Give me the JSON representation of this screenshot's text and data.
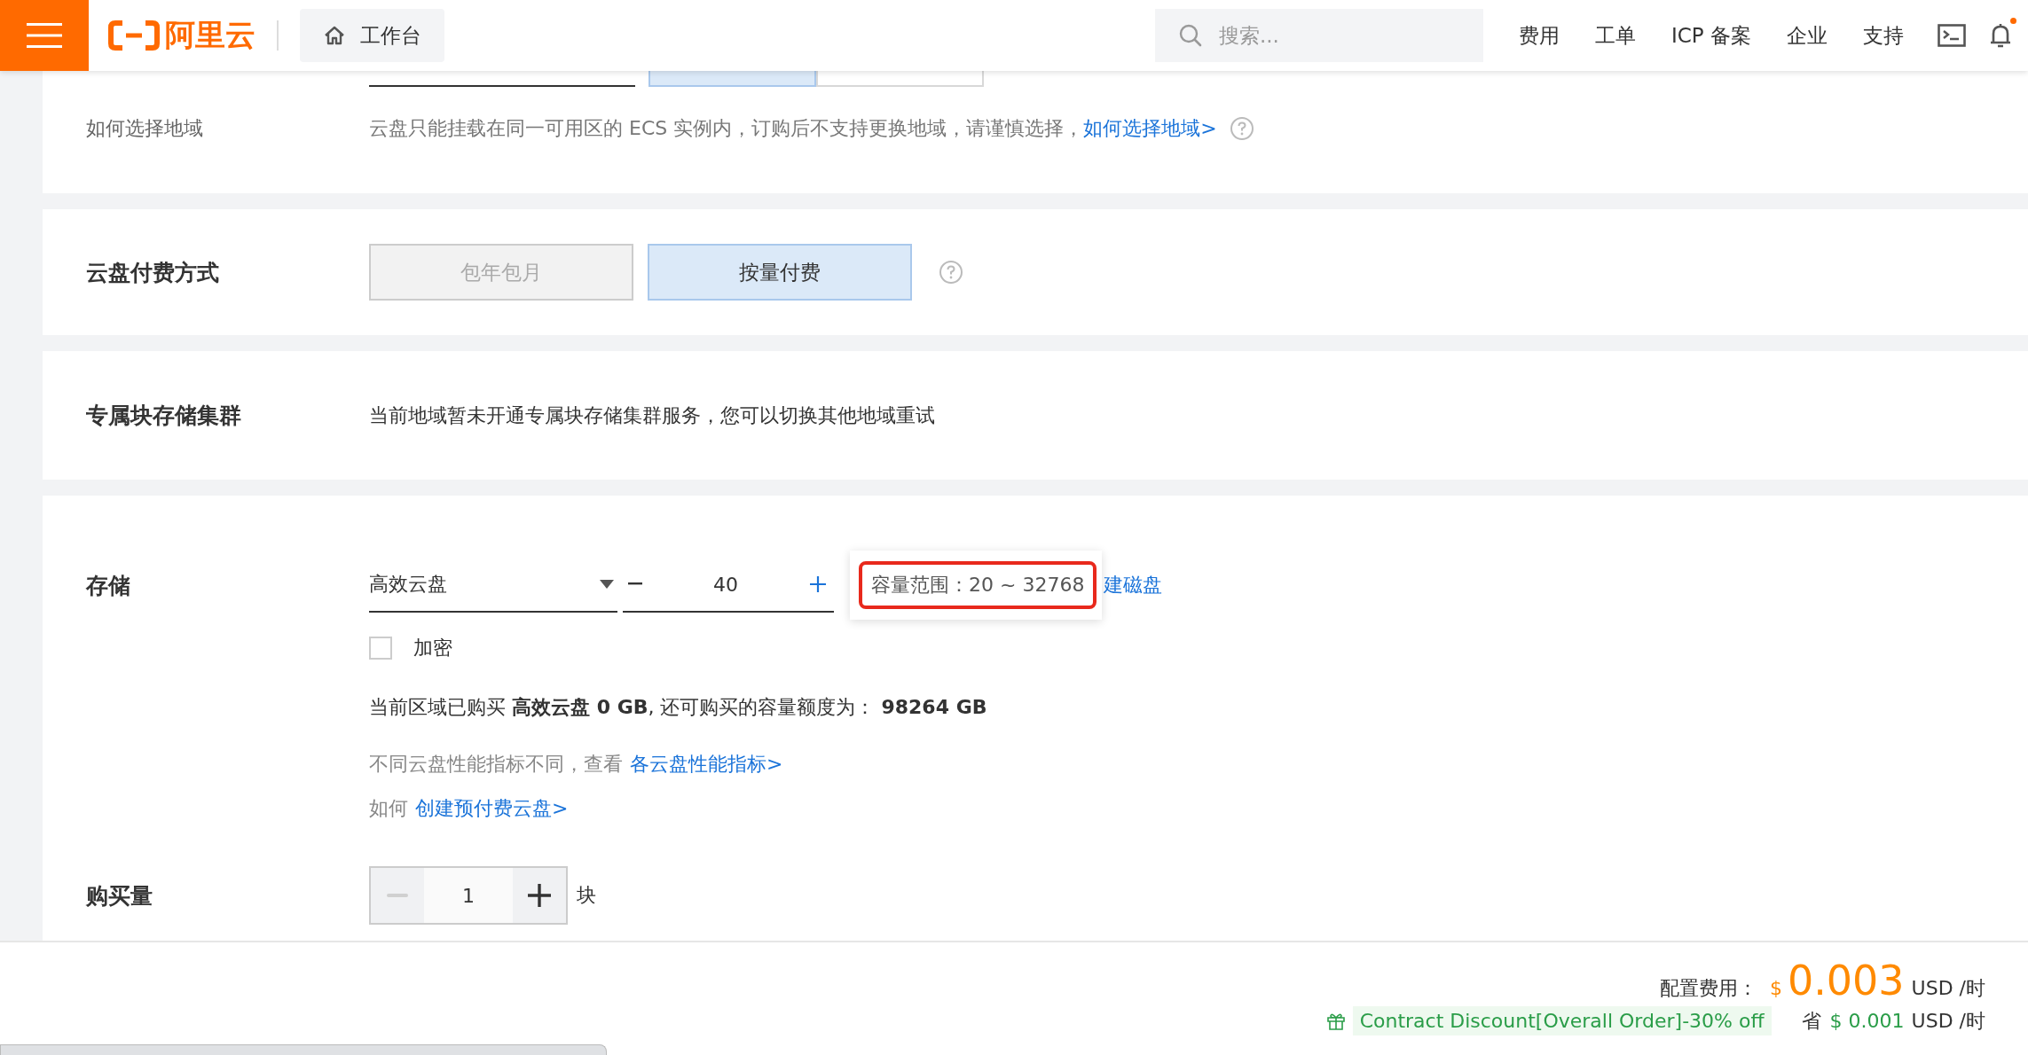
{
  "header": {
    "logo": "阿里云",
    "workbench": "工作台",
    "search": {
      "placeholder": "搜索..."
    },
    "nav": [
      "费用",
      "工单",
      "ICP 备案",
      "企业",
      "支持"
    ],
    "notification_dot": true
  },
  "region_section": {
    "label": "如何选择地域",
    "note": "云盘只能挂载在同一可用区的 ECS 实例内，订购后不支持更换地域，请谨慎选择，",
    "link": "如何选择地域>"
  },
  "billing": {
    "label": "云盘付费方式",
    "options": [
      {
        "label": "包年包月",
        "selected": false,
        "disabled": true
      },
      {
        "label": "按量付费",
        "selected": true,
        "disabled": false
      }
    ]
  },
  "dedicated": {
    "label": "专属块存储集群",
    "text": "当前地域暂未开通专属块存储集群服务，您可以切换其他地域重试"
  },
  "storage": {
    "label": "存储",
    "disk_type": "高效云盘",
    "size": "40",
    "tooltip": "容量范围：20 ~ 32768",
    "create_link": "建磁盘",
    "encrypt": {
      "label": "加密",
      "checked": false
    },
    "quota": "当前区域已购买 **高效云盘 0 GB**, 还可购买的容量额度为： **98264 GB**",
    "perf_note": "不同云盘性能指标不同，查看",
    "perf_link": "各云盘性能指标>",
    "prepaid_prefix": "如何",
    "prepaid_link": "创建预付费云盘>"
  },
  "quantity": {
    "label": "购买量",
    "value": "1",
    "unit": "块",
    "decrement_disabled": true
  },
  "footer": {
    "cost_label": "配置费用：",
    "currency": "$",
    "cost": "0.003",
    "cost_unit": "USD /时",
    "discount": "Contract Discount[Overall Order]-30% off",
    "save_label": "省",
    "save_amount": "$ 0.001",
    "save_unit": "USD /时"
  }
}
